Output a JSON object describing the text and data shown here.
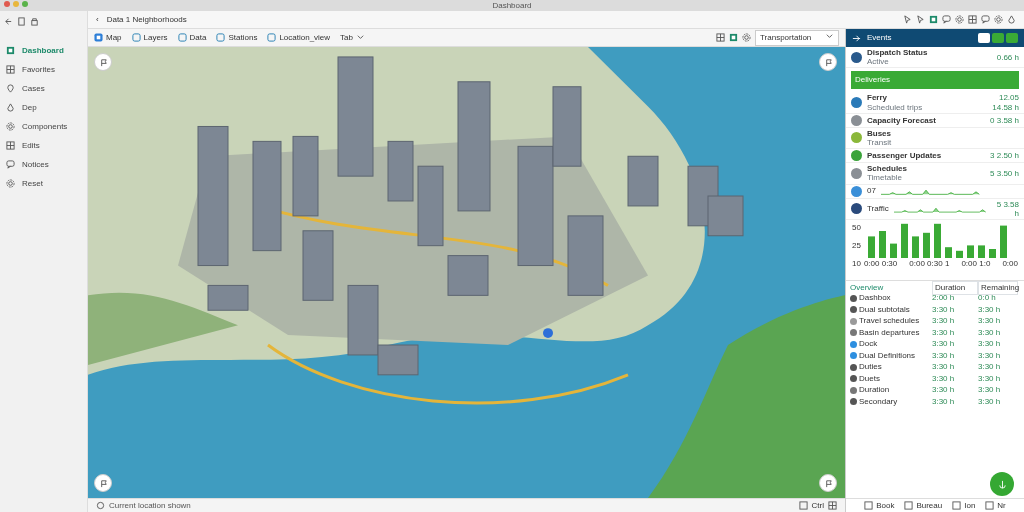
{
  "window": {
    "title": "Dashboard"
  },
  "sidebar": {
    "items": [
      {
        "label": "Dashboard",
        "selected": true
      },
      {
        "label": "Favorites",
        "selected": false
      },
      {
        "label": "Cases",
        "selected": false
      },
      {
        "label": "Dep",
        "selected": false
      },
      {
        "label": "Components",
        "selected": false
      },
      {
        "label": "Edits",
        "selected": false
      },
      {
        "label": "Notices",
        "selected": false
      },
      {
        "label": "Reset",
        "selected": false
      }
    ]
  },
  "breadcrumb": {
    "back": "‹",
    "path": "Data 1 Neighborhoods"
  },
  "toolbar": {
    "items": [
      {
        "label": "Map",
        "kind": "plain"
      },
      {
        "label": "Layers",
        "kind": "icon"
      },
      {
        "label": "Data",
        "kind": "icon"
      },
      {
        "label": "Stations",
        "kind": "icon"
      },
      {
        "label": "Location_view",
        "kind": "icon"
      },
      {
        "label": "Tab",
        "kind": "menu"
      }
    ],
    "select": {
      "value": "Transportation"
    }
  },
  "panel": {
    "title": "Events",
    "items": [
      {
        "kind": "item",
        "color": "#2a5a8c",
        "title": "Dispatch Status",
        "subtitle": "Active",
        "value": "0.66 h"
      },
      {
        "kind": "banner",
        "title": "Deliveries"
      },
      {
        "kind": "item",
        "color": "#2a7ab8",
        "title": "Ferry",
        "subtitle": "Scheduled trips",
        "value": "12.05",
        "value2": "14.58 h"
      },
      {
        "kind": "item",
        "color": "#8a8f95",
        "title": "Capacity Forecast",
        "value": "0 3.58 h"
      },
      {
        "kind": "item",
        "color": "#8bb83a",
        "title": "Buses",
        "subtitle": "Transit"
      },
      {
        "kind": "item",
        "color": "#3aa33a",
        "title": "Passenger Updates",
        "value": "3 2.50 h"
      },
      {
        "kind": "item",
        "color": "#8a8f95",
        "title": "Schedules",
        "subtitle": "Timetable",
        "value2": "5 3.50 h"
      },
      {
        "kind": "spark",
        "color": "#3a8fd8",
        "title": "07"
      },
      {
        "kind": "spark",
        "color": "#2a4a7c",
        "title": "Traffic",
        "value": "5 3.58 h"
      }
    ],
    "chart": {
      "yticks": [
        "50",
        "25",
        "10"
      ],
      "xlabels": [
        "0:00 0:30",
        "0:00 0:30 1",
        "0:00 1:0",
        "0:00"
      ]
    },
    "table": {
      "columns": [
        "Overview",
        "Duration",
        "Remaining"
      ],
      "rows": [
        {
          "color": "#555555",
          "name": "Dashbox",
          "duration": "2:00 h",
          "remaining": "0:0 h"
        },
        {
          "color": "#555555",
          "name": "Dual subtotals",
          "duration": "3:30 h",
          "remaining": "3:30 h"
        },
        {
          "color": "#9a9a9a",
          "name": "Travel schedules",
          "duration": "3:30 h",
          "remaining": "3:30 h"
        },
        {
          "color": "#777777",
          "name": "Basin departures",
          "duration": "3:30 h",
          "remaining": "3:30 h"
        },
        {
          "color": "#2d8fe0",
          "name": "Dock",
          "duration": "3:30 h",
          "remaining": "3:30 h"
        },
        {
          "color": "#2d8fe0",
          "name": "Dual Definitions",
          "duration": "3:30 h",
          "remaining": "3:30 h"
        },
        {
          "color": "#555555",
          "name": "Duties",
          "duration": "3:30 h",
          "remaining": "3:30 h"
        },
        {
          "color": "#555555",
          "name": "Duets",
          "duration": "3:30 h",
          "remaining": "3:30 h"
        },
        {
          "color": "#777777",
          "name": "Duration",
          "duration": "3:30 h",
          "remaining": "3:30 h"
        },
        {
          "color": "#555555",
          "name": "Secondary",
          "duration": "3:30 h",
          "remaining": "3:30 h"
        }
      ]
    },
    "bottom": [
      {
        "label": "Book"
      },
      {
        "label": "Bureau"
      },
      {
        "label": "Ion"
      },
      {
        "label": "Nr"
      }
    ]
  },
  "status_bar": {
    "text": "Current location shown",
    "right": "Ctrl"
  }
}
